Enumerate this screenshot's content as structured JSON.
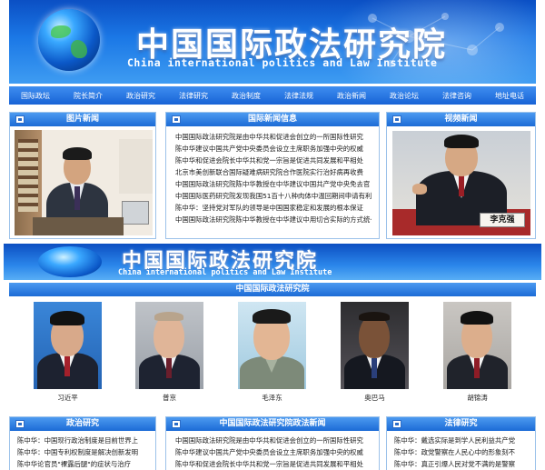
{
  "banner": {
    "title_cn": "中国国际政法研究院",
    "title_en": "China international politics and Law Institute"
  },
  "nav": {
    "items": [
      "国际政坛",
      "院长简介",
      "政治研究",
      "法律研究",
      "政治制度",
      "法律法规",
      "政治新闻",
      "政治论坛",
      "法律咨询",
      "地址电话"
    ]
  },
  "panels": {
    "photo_news": {
      "title": "图片新闻"
    },
    "intl_news": {
      "title": "国际新闻信息",
      "items": [
        "中国国际政法研究院是由中华共和促进会创立的一所国际性研究",
        "陈中华建议中国共产党中央委员会设立主席职务加强中央的权威",
        "陈中华和促进会院长中华共和党一宗旨是促进共同发展和平相处",
        "北京市美创新联合国际疑难病研究院合作医院实行治好病再收费",
        "中国国际政法研究院陈中华教授在中华建议中国共产党中央免去官",
        "中国国际医药研究院发现我国51百十八种肉体中温回期间申请有利",
        "陈中华：坚持党对军队的领导是中国国家稳定和发展的根本保证",
        "中国国际政法研究院陈中华教授在中华建议中用切合实际的方式统一中国"
      ]
    },
    "video_news": {
      "title": "视频新闻",
      "caption": "李克强"
    }
  },
  "banner2": {
    "title_cn": "中国国际政法研究院",
    "title_en": "China international politics and Law Institute"
  },
  "leaders": {
    "title": "中国国际政法研究院",
    "people": [
      {
        "name": "习近平"
      },
      {
        "name": "普京"
      },
      {
        "name": "毛泽东"
      },
      {
        "name": "奥巴马"
      },
      {
        "name": "胡锦涛"
      }
    ]
  },
  "bottom": {
    "politics": {
      "title": "政治研究",
      "items": [
        "陈中华：中国现行政治制度是目前世界上",
        "陈中华：中国专利权制度是解决创新发明",
        "陈中华论官员\"裸露后腿\"的症状与治疗"
      ]
    },
    "institute_news": {
      "title": "中国国际政法研究院政法新闻",
      "items": [
        "中国国际政法研究院是由中华共和促进会创立的一所国际性研究",
        "陈中华建议中国共产党中央委员会设立主席职务加强中央的权威",
        "陈中华和促进会院长中华共和党一宗旨是促进共同发展和平相处"
      ]
    },
    "law": {
      "title": "法律研究",
      "items": [
        "陈中华：戴选实际是到学人民利益共产党",
        "陈中华：政党警察在人民心中的形象刻不",
        "陈中华：真正引爆人民对党不满的是警察"
      ]
    }
  },
  "colors": {
    "header_blue": "#1c6bd6",
    "banner_blue": "#0b4fc4",
    "panel_border": "#9cc2ea"
  }
}
